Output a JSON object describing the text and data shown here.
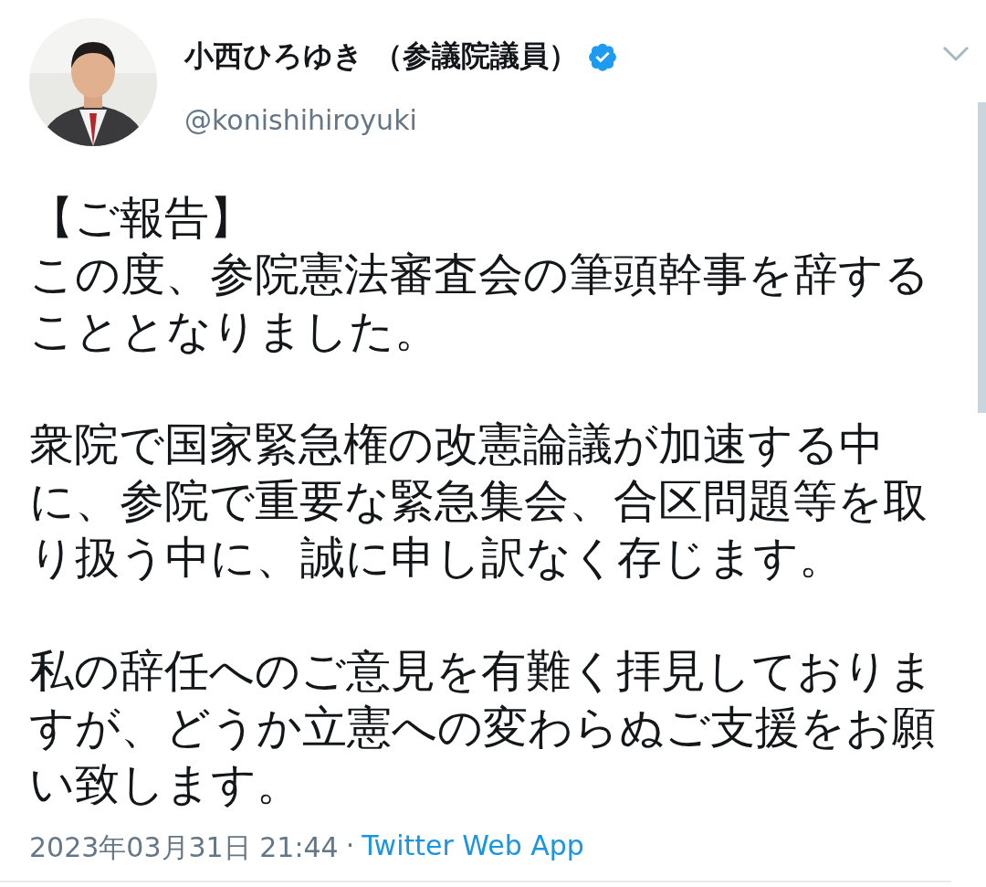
{
  "tweet": {
    "author": {
      "name": "小西ひろゆき （参議院議員）",
      "verified": true,
      "handle": "@konishihiroyuki"
    },
    "heading": "【ご報告】",
    "text": [
      "この度、参院憲法審査会の筆頭幹事を辞することとなりました。",
      "衆院で国家緊急権の改憲論議が加速する中に、参院で重要な緊急集会、合区問題等を取り扱う中に、誠に申し訳なく存じます。",
      "私の辞任へのご意見を有難く拝見しておりますが、どうか立憲への変わらぬご支援をお願い致します。"
    ],
    "timestamp": "2023年03月31日 21:44",
    "separator": "·",
    "source": "Twitter Web App"
  }
}
